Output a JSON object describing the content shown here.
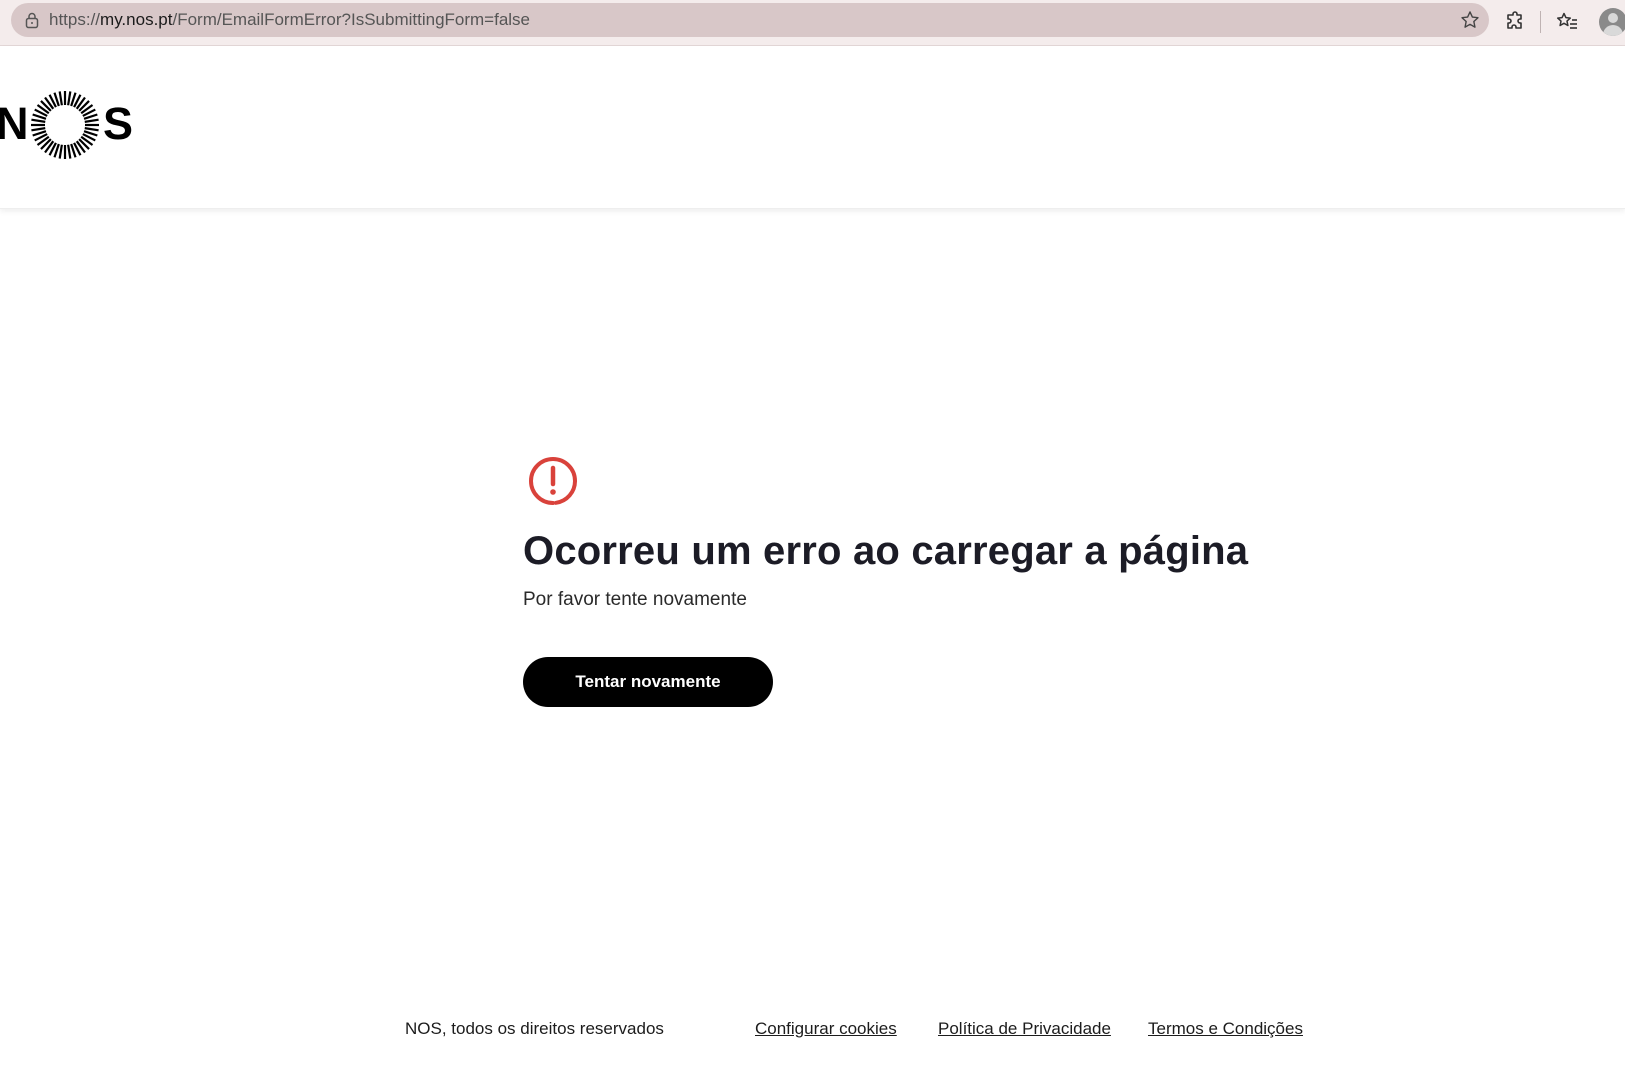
{
  "browser": {
    "url_prefix": "https://",
    "url_host": "my.nos.pt",
    "url_path": "/Form/EmailFormError?IsSubmittingForm=false",
    "icons": {
      "lock": "lock-icon",
      "bookmark": "star-icon",
      "extensions": "puzzle-icon",
      "favorites": "favorites-icon",
      "profile": "profile-avatar-icon"
    }
  },
  "header": {
    "logo": {
      "text": "NOS",
      "letter_left": "N",
      "letter_right": "S"
    }
  },
  "error": {
    "icon": "exclamation-circle-icon",
    "icon_color": "#d9423b",
    "title": "Ocorreu um erro ao carregar a página",
    "subtitle": "Por favor tente novamente",
    "retry_label": "Tentar novamente"
  },
  "footer": {
    "copyright": "NOS, todos os direitos reservados",
    "links": {
      "cookies": "Configurar cookies",
      "privacy": "Política de Privacidade",
      "terms": "Termos e Condições"
    }
  },
  "colors": {
    "button_bg": "#000000",
    "button_text": "#ffffff",
    "chrome_bg": "#f4ecec",
    "omnibox_bg": "#d8c7c8"
  }
}
